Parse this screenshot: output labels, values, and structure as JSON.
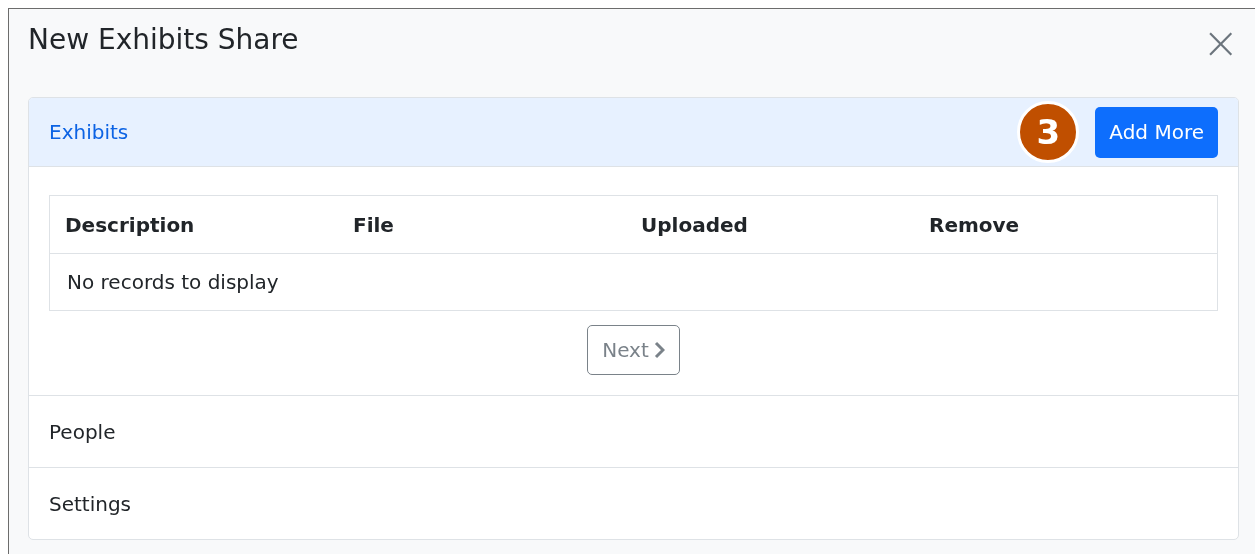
{
  "dialog": {
    "title": "New Exhibits Share",
    "close": "×"
  },
  "sections": [
    {
      "title": "Exhibits",
      "expanded": true,
      "step_badge": "3",
      "action": "Add More",
      "table": {
        "columns": [
          "Description",
          "File",
          "Uploaded",
          "Remove"
        ],
        "empty_message": "No records to display"
      },
      "pager": {
        "label": "Next",
        "disabled": true
      }
    },
    {
      "title": "People",
      "expanded": false
    },
    {
      "title": "Settings",
      "expanded": false
    }
  ]
}
